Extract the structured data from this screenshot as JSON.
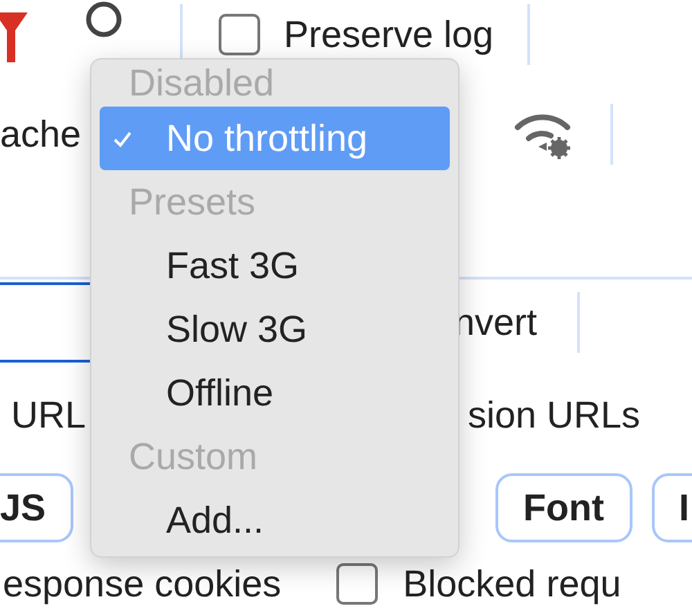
{
  "toolbar": {
    "filter_active": true,
    "preserve_log": {
      "label": "Preserve log",
      "checked": false
    },
    "disable_cache": {
      "label": "ache"
    }
  },
  "filter_row": {
    "invert": {
      "label": "nvert"
    }
  },
  "url_options": [
    {
      "label": "URL"
    },
    {
      "label": "sion URLs"
    }
  ],
  "type_chips": [
    {
      "label": "JS"
    },
    {
      "label": "Font"
    },
    {
      "label": "I"
    }
  ],
  "bottom_options": [
    {
      "label": "esponse cookies"
    },
    {
      "label": "Blocked requ",
      "checked": false
    }
  ],
  "throttling_menu": {
    "items": [
      {
        "kind": "header",
        "label": "Disabled"
      },
      {
        "kind": "option",
        "label": "No throttling",
        "selected": true
      },
      {
        "kind": "header",
        "label": "Presets"
      },
      {
        "kind": "option",
        "label": "Fast 3G",
        "selected": false
      },
      {
        "kind": "option",
        "label": "Slow 3G",
        "selected": false
      },
      {
        "kind": "option",
        "label": "Offline",
        "selected": false
      },
      {
        "kind": "header",
        "label": "Custom"
      },
      {
        "kind": "option",
        "label": "Add...",
        "selected": false
      }
    ]
  }
}
